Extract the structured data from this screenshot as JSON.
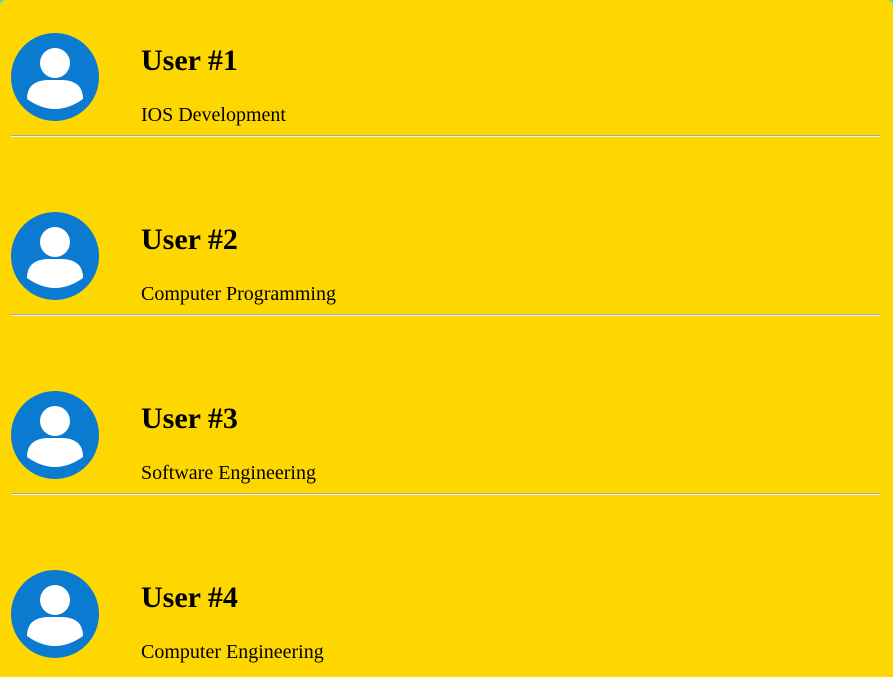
{
  "colors": {
    "page_background": "#ffd700",
    "outer_background": "#30e0d0",
    "avatar_background": "#0a7bd0",
    "avatar_figure": "#ffffff",
    "divider": "#a9a9a9"
  },
  "users": [
    {
      "name": "User #1",
      "role": "IOS Development",
      "avatar_icon": "user-avatar-icon"
    },
    {
      "name": "User #2",
      "role": "Computer Programming",
      "avatar_icon": "user-avatar-icon"
    },
    {
      "name": "User #3",
      "role": "Software Engineering",
      "avatar_icon": "user-avatar-icon"
    },
    {
      "name": "User #4",
      "role": "Computer Engineering",
      "avatar_icon": "user-avatar-icon"
    }
  ]
}
